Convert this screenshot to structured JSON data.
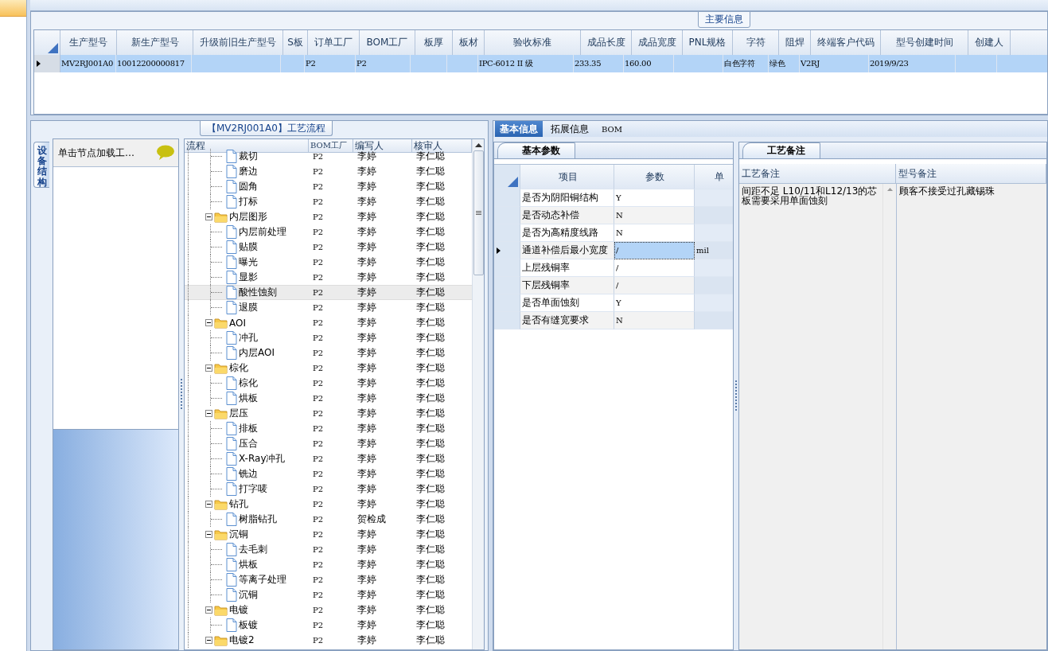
{
  "main_info": {
    "title": "主要信息",
    "columns": [
      "生产型号",
      "新生产型号",
      "升级前旧生产型号",
      "S板",
      "订单工厂",
      "BOM工厂",
      "板厚",
      "板材",
      "验收标准",
      "成品长度",
      "成品宽度",
      "PNL规格",
      "字符",
      "阻焊",
      "终端客户代码",
      "型号创建时间",
      "创建人"
    ],
    "rows": [
      {
        "selected": true,
        "cells": [
          "MV2RJ001A0",
          "10012200000817",
          "",
          "",
          "P2",
          "P2",
          "",
          "",
          "IPC-6012 II 级",
          "233.35",
          "160.00",
          "",
          "白色字符",
          "绿色",
          "V2RJ",
          "2019/9/23",
          ""
        ]
      }
    ]
  },
  "flow_panel": {
    "title": "【MV2RJ001A0】工艺流程",
    "side_tab": "设备结构",
    "card_title": "单击节点加载工…",
    "tree_columns": [
      "流程",
      "BOM工厂",
      "编写人",
      "核审人"
    ],
    "tree": [
      {
        "children": [
          {
            "kind": "file",
            "label": "裁切",
            "cells": [
              "P2",
              "李婷",
              "李仁聪"
            ],
            "selected": false
          },
          {
            "kind": "file",
            "label": "磨边",
            "cells": [
              "P2",
              "李婷",
              "李仁聪"
            ],
            "selected": false
          },
          {
            "kind": "file",
            "label": "圆角",
            "cells": [
              "P2",
              "李婷",
              "李仁聪"
            ],
            "selected": false
          },
          {
            "kind": "file",
            "label": "打标",
            "cells": [
              "P2",
              "李婷",
              "李仁聪"
            ],
            "selected": false
          }
        ]
      },
      {
        "kind": "folder",
        "label": "内层图形",
        "cells": [
          "P2",
          "李婷",
          "李仁聪"
        ],
        "selected": false,
        "expanded": true,
        "children": [
          {
            "kind": "file",
            "label": "内层前处理",
            "cells": [
              "P2",
              "李婷",
              "李仁聪"
            ],
            "selected": false
          },
          {
            "kind": "file",
            "label": "贴膜",
            "cells": [
              "P2",
              "李婷",
              "李仁聪"
            ],
            "selected": false
          },
          {
            "kind": "file",
            "label": "曝光",
            "cells": [
              "P2",
              "李婷",
              "李仁聪"
            ],
            "selected": false
          },
          {
            "kind": "file",
            "label": "显影",
            "cells": [
              "P2",
              "李婷",
              "李仁聪"
            ],
            "selected": false
          },
          {
            "kind": "file",
            "label": "酸性蚀刻",
            "cells": [
              "P2",
              "李婷",
              "李仁聪"
            ],
            "selected": true
          },
          {
            "kind": "file",
            "label": "退膜",
            "cells": [
              "P2",
              "李婷",
              "李仁聪"
            ],
            "selected": false
          }
        ]
      },
      {
        "kind": "folder",
        "label": "AOI",
        "cells": [
          "P2",
          "李婷",
          "李仁聪"
        ],
        "selected": false,
        "expanded": true,
        "children": [
          {
            "kind": "file",
            "label": "冲孔",
            "cells": [
              "P2",
              "李婷",
              "李仁聪"
            ],
            "selected": false
          },
          {
            "kind": "file",
            "label": "内层AOI",
            "cells": [
              "P2",
              "李婷",
              "李仁聪"
            ],
            "selected": false
          }
        ]
      },
      {
        "kind": "folder",
        "label": "棕化",
        "cells": [
          "P2",
          "李婷",
          "李仁聪"
        ],
        "selected": false,
        "expanded": true,
        "children": [
          {
            "kind": "file",
            "label": "棕化",
            "cells": [
              "P2",
              "李婷",
              "李仁聪"
            ],
            "selected": false
          },
          {
            "kind": "file",
            "label": "烘板",
            "cells": [
              "P2",
              "李婷",
              "李仁聪"
            ],
            "selected": false
          }
        ]
      },
      {
        "kind": "folder",
        "label": "层压",
        "cells": [
          "P2",
          "李婷",
          "李仁聪"
        ],
        "selected": false,
        "expanded": true,
        "children": [
          {
            "kind": "file",
            "label": "排板",
            "cells": [
              "P2",
              "李婷",
              "李仁聪"
            ],
            "selected": false
          },
          {
            "kind": "file",
            "label": "压合",
            "cells": [
              "P2",
              "李婷",
              "李仁聪"
            ],
            "selected": false
          },
          {
            "kind": "file",
            "label": "X-Ray冲孔",
            "cells": [
              "P2",
              "李婷",
              "李仁聪"
            ],
            "selected": false
          },
          {
            "kind": "file",
            "label": "铣边",
            "cells": [
              "P2",
              "李婷",
              "李仁聪"
            ],
            "selected": false
          },
          {
            "kind": "file",
            "label": "打字唛",
            "cells": [
              "P2",
              "李婷",
              "李仁聪"
            ],
            "selected": false
          }
        ]
      },
      {
        "kind": "folder",
        "label": "钻孔",
        "cells": [
          "P2",
          "李婷",
          "李仁聪"
        ],
        "selected": false,
        "expanded": true,
        "children": [
          {
            "kind": "file",
            "label": "树脂钻孔",
            "cells": [
              "P2",
              "贺检成",
              "李仁聪"
            ],
            "selected": false
          }
        ]
      },
      {
        "kind": "folder",
        "label": "沉铜",
        "cells": [
          "P2",
          "李婷",
          "李仁聪"
        ],
        "selected": false,
        "expanded": true,
        "children": [
          {
            "kind": "file",
            "label": "去毛刺",
            "cells": [
              "P2",
              "李婷",
              "李仁聪"
            ],
            "selected": false
          },
          {
            "kind": "file",
            "label": "烘板",
            "cells": [
              "P2",
              "李婷",
              "李仁聪"
            ],
            "selected": false
          },
          {
            "kind": "file",
            "label": "等离子处理",
            "cells": [
              "P2",
              "李婷",
              "李仁聪"
            ],
            "selected": false
          },
          {
            "kind": "file",
            "label": "沉铜",
            "cells": [
              "P2",
              "李婷",
              "李仁聪"
            ],
            "selected": false
          }
        ]
      },
      {
        "kind": "folder",
        "label": "电镀",
        "cells": [
          "P2",
          "李婷",
          "李仁聪"
        ],
        "selected": false,
        "expanded": true,
        "children": [
          {
            "kind": "file",
            "label": "板镀",
            "cells": [
              "P2",
              "李婷",
              "李仁聪"
            ],
            "selected": false
          }
        ]
      },
      {
        "kind": "folder",
        "label": "电镀2",
        "cells": [
          "P2",
          "李婷",
          "李仁聪"
        ],
        "selected": false,
        "expanded": true
      }
    ]
  },
  "detail_tabs": [
    {
      "label": "基本信息",
      "selected": true
    },
    {
      "label": "拓展信息",
      "selected": false
    },
    {
      "label": "BOM",
      "selected": false
    }
  ],
  "params": {
    "title": "基本参数",
    "columns": [
      "项目",
      "参数",
      "单"
    ],
    "rows": [
      {
        "item": "是否为阴阳铜结构",
        "value": "Y",
        "selected": false
      },
      {
        "item": "是否动态补偿",
        "value": "N",
        "selected": false
      },
      {
        "item": "是否为高精度线路",
        "value": "N",
        "selected": false
      },
      {
        "item": "通道补偿后最小宽度",
        "value": "/",
        "unit": "mil",
        "selected": true
      },
      {
        "item": "上层残铜率",
        "value": "/",
        "selected": false
      },
      {
        "item": "下层残铜率",
        "value": "/",
        "selected": false
      },
      {
        "item": "是否单面蚀刻",
        "value": "Y",
        "selected": false
      },
      {
        "item": "是否有缝宽要求",
        "value": "N",
        "selected": false
      }
    ]
  },
  "remarks": {
    "title": "工艺备注",
    "columns": [
      "工艺备注",
      "型号备注"
    ],
    "values": [
      "间距不足 L10/11和L12/13的芯板需要采用单面蚀刻",
      "顾客不接受过孔藏锡珠"
    ]
  }
}
